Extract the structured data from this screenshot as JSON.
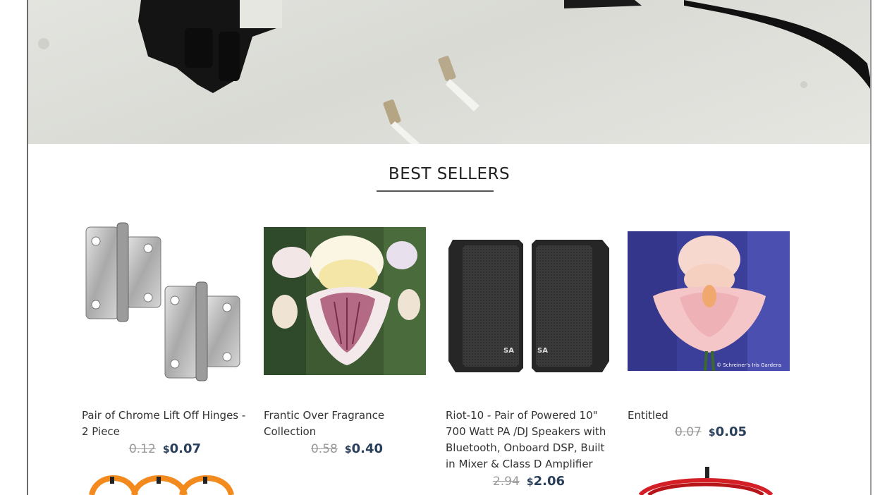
{
  "section": {
    "title": "BEST SELLERS"
  },
  "products": [
    {
      "name": "Pair of Chrome Lift Off Hinges - 2 Piece",
      "old_price": "0.12",
      "currency": "$",
      "price": "0.07",
      "image": "chrome-hinges"
    },
    {
      "name": "Frantic Over Fragrance Collection",
      "old_price": "0.58",
      "currency": "$",
      "price": "0.40",
      "image": "iris-flower-purple-white"
    },
    {
      "name": "Riot-10 - Pair of Powered 10\" 700 Watt PA /DJ Speakers with Bluetooth, Onboard DSP, Built in Mixer & Class D Amplifier",
      "old_price": "2.94",
      "currency": "$",
      "price": "2.06",
      "image": "pa-speakers"
    },
    {
      "name": "Entitled",
      "old_price": "0.07",
      "currency": "$",
      "price": "0.05",
      "image": "iris-flower-pink"
    }
  ],
  "watermark": "© Schreiner's Iris Gardens",
  "speaker_logo": "SA",
  "colors": {
    "price": "#2a3f5a",
    "old_price": "#999999",
    "title_rule": "#555555"
  }
}
